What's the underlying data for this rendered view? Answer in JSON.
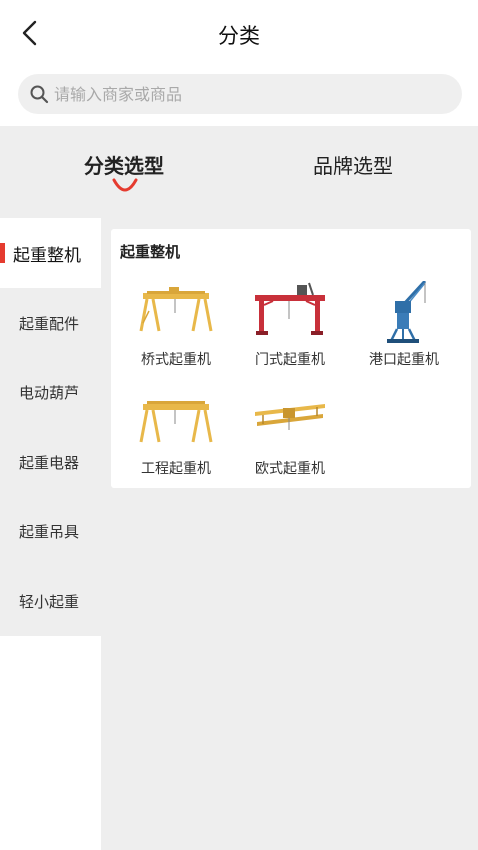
{
  "header": {
    "title": "分类"
  },
  "search": {
    "placeholder": "请输入商家或商品"
  },
  "tabs": [
    {
      "label": "分类选型",
      "active": true
    },
    {
      "label": "品牌选型",
      "active": false
    }
  ],
  "sidebar": {
    "items": [
      {
        "label": "起重整机",
        "active": true
      },
      {
        "label": "起重配件"
      },
      {
        "label": "电动葫芦"
      },
      {
        "label": "起重电器"
      },
      {
        "label": "起重吊具"
      },
      {
        "label": "轻小起重"
      }
    ]
  },
  "panel": {
    "title": "起重整机",
    "products": [
      {
        "label": "桥式起重机",
        "icon": "bridge-crane-icon"
      },
      {
        "label": "门式起重机",
        "icon": "gantry-crane-icon"
      },
      {
        "label": "港口起重机",
        "icon": "port-crane-icon"
      },
      {
        "label": "工程起重机",
        "icon": "engineering-crane-icon"
      },
      {
        "label": "欧式起重机",
        "icon": "european-crane-icon"
      }
    ]
  },
  "colors": {
    "accent": "#e53b2f",
    "background": "#eeeeee",
    "crane_yellow": "#e8b84a",
    "crane_red": "#c8303a",
    "crane_blue": "#2f6fa8"
  }
}
